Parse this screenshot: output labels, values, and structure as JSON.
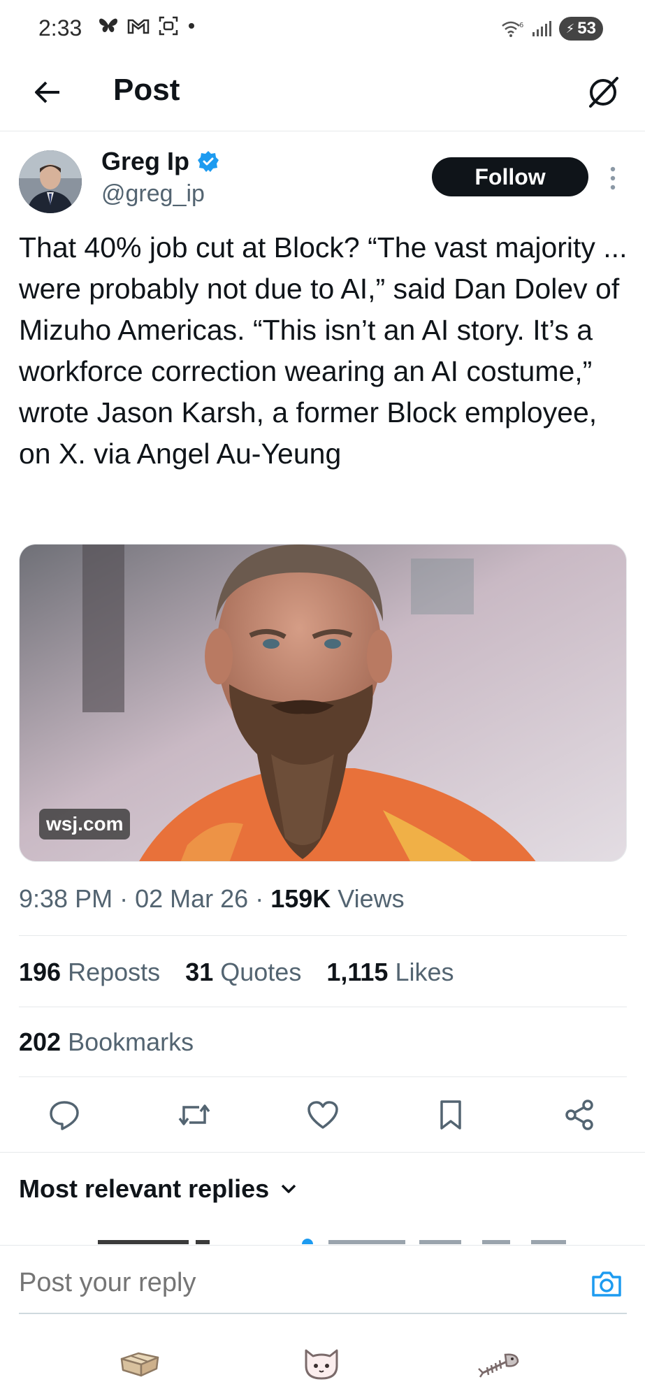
{
  "status_bar": {
    "time": "2:33",
    "battery": "53",
    "icons": [
      "butterfly-icon",
      "gmail-icon",
      "screenshot-icon",
      "dot-icon",
      "wifi-icon",
      "signal-icon",
      "battery-icon"
    ]
  },
  "header": {
    "title": "Post",
    "back_icon": "arrow-left-icon",
    "grok_icon": "grok-icon"
  },
  "post": {
    "author_name": "Greg Ip",
    "author_handle": "@greg_ip",
    "verified": true,
    "follow_label": "Follow",
    "text": "That 40% job cut at Block? “The vast majority ... were probably not due to AI,” said Dan Dolev of Mizuho Americas. “This isn’t an AI story. It’s a workforce correction wearing an AI costume,” wrote Jason Karsh, a former Block employee, on X. via Angel Au-Yeung",
    "media_domain": "wsj.com",
    "time": "9:38 PM",
    "date": "02 Mar 26",
    "views_count": "159K",
    "views_label": "Views",
    "reposts_count": "196",
    "reposts_label": "Reposts",
    "quotes_count": "31",
    "quotes_label": "Quotes",
    "likes_count": "1,115",
    "likes_label": "Likes",
    "bookmarks_count": "202",
    "bookmarks_label": "Bookmarks"
  },
  "actions": [
    "reply-icon",
    "repost-icon",
    "like-icon",
    "bookmark-icon",
    "share-icon"
  ],
  "replies": {
    "filter_label": "Most relevant replies"
  },
  "reply_bar": {
    "placeholder": "Post your reply"
  },
  "nav": [
    "box-icon",
    "cat-icon",
    "fishbone-icon"
  ],
  "colors": {
    "accent": "#1d9bf0",
    "text": "#0f1419",
    "secondary": "#536471",
    "divider": "#e6e9eb"
  }
}
